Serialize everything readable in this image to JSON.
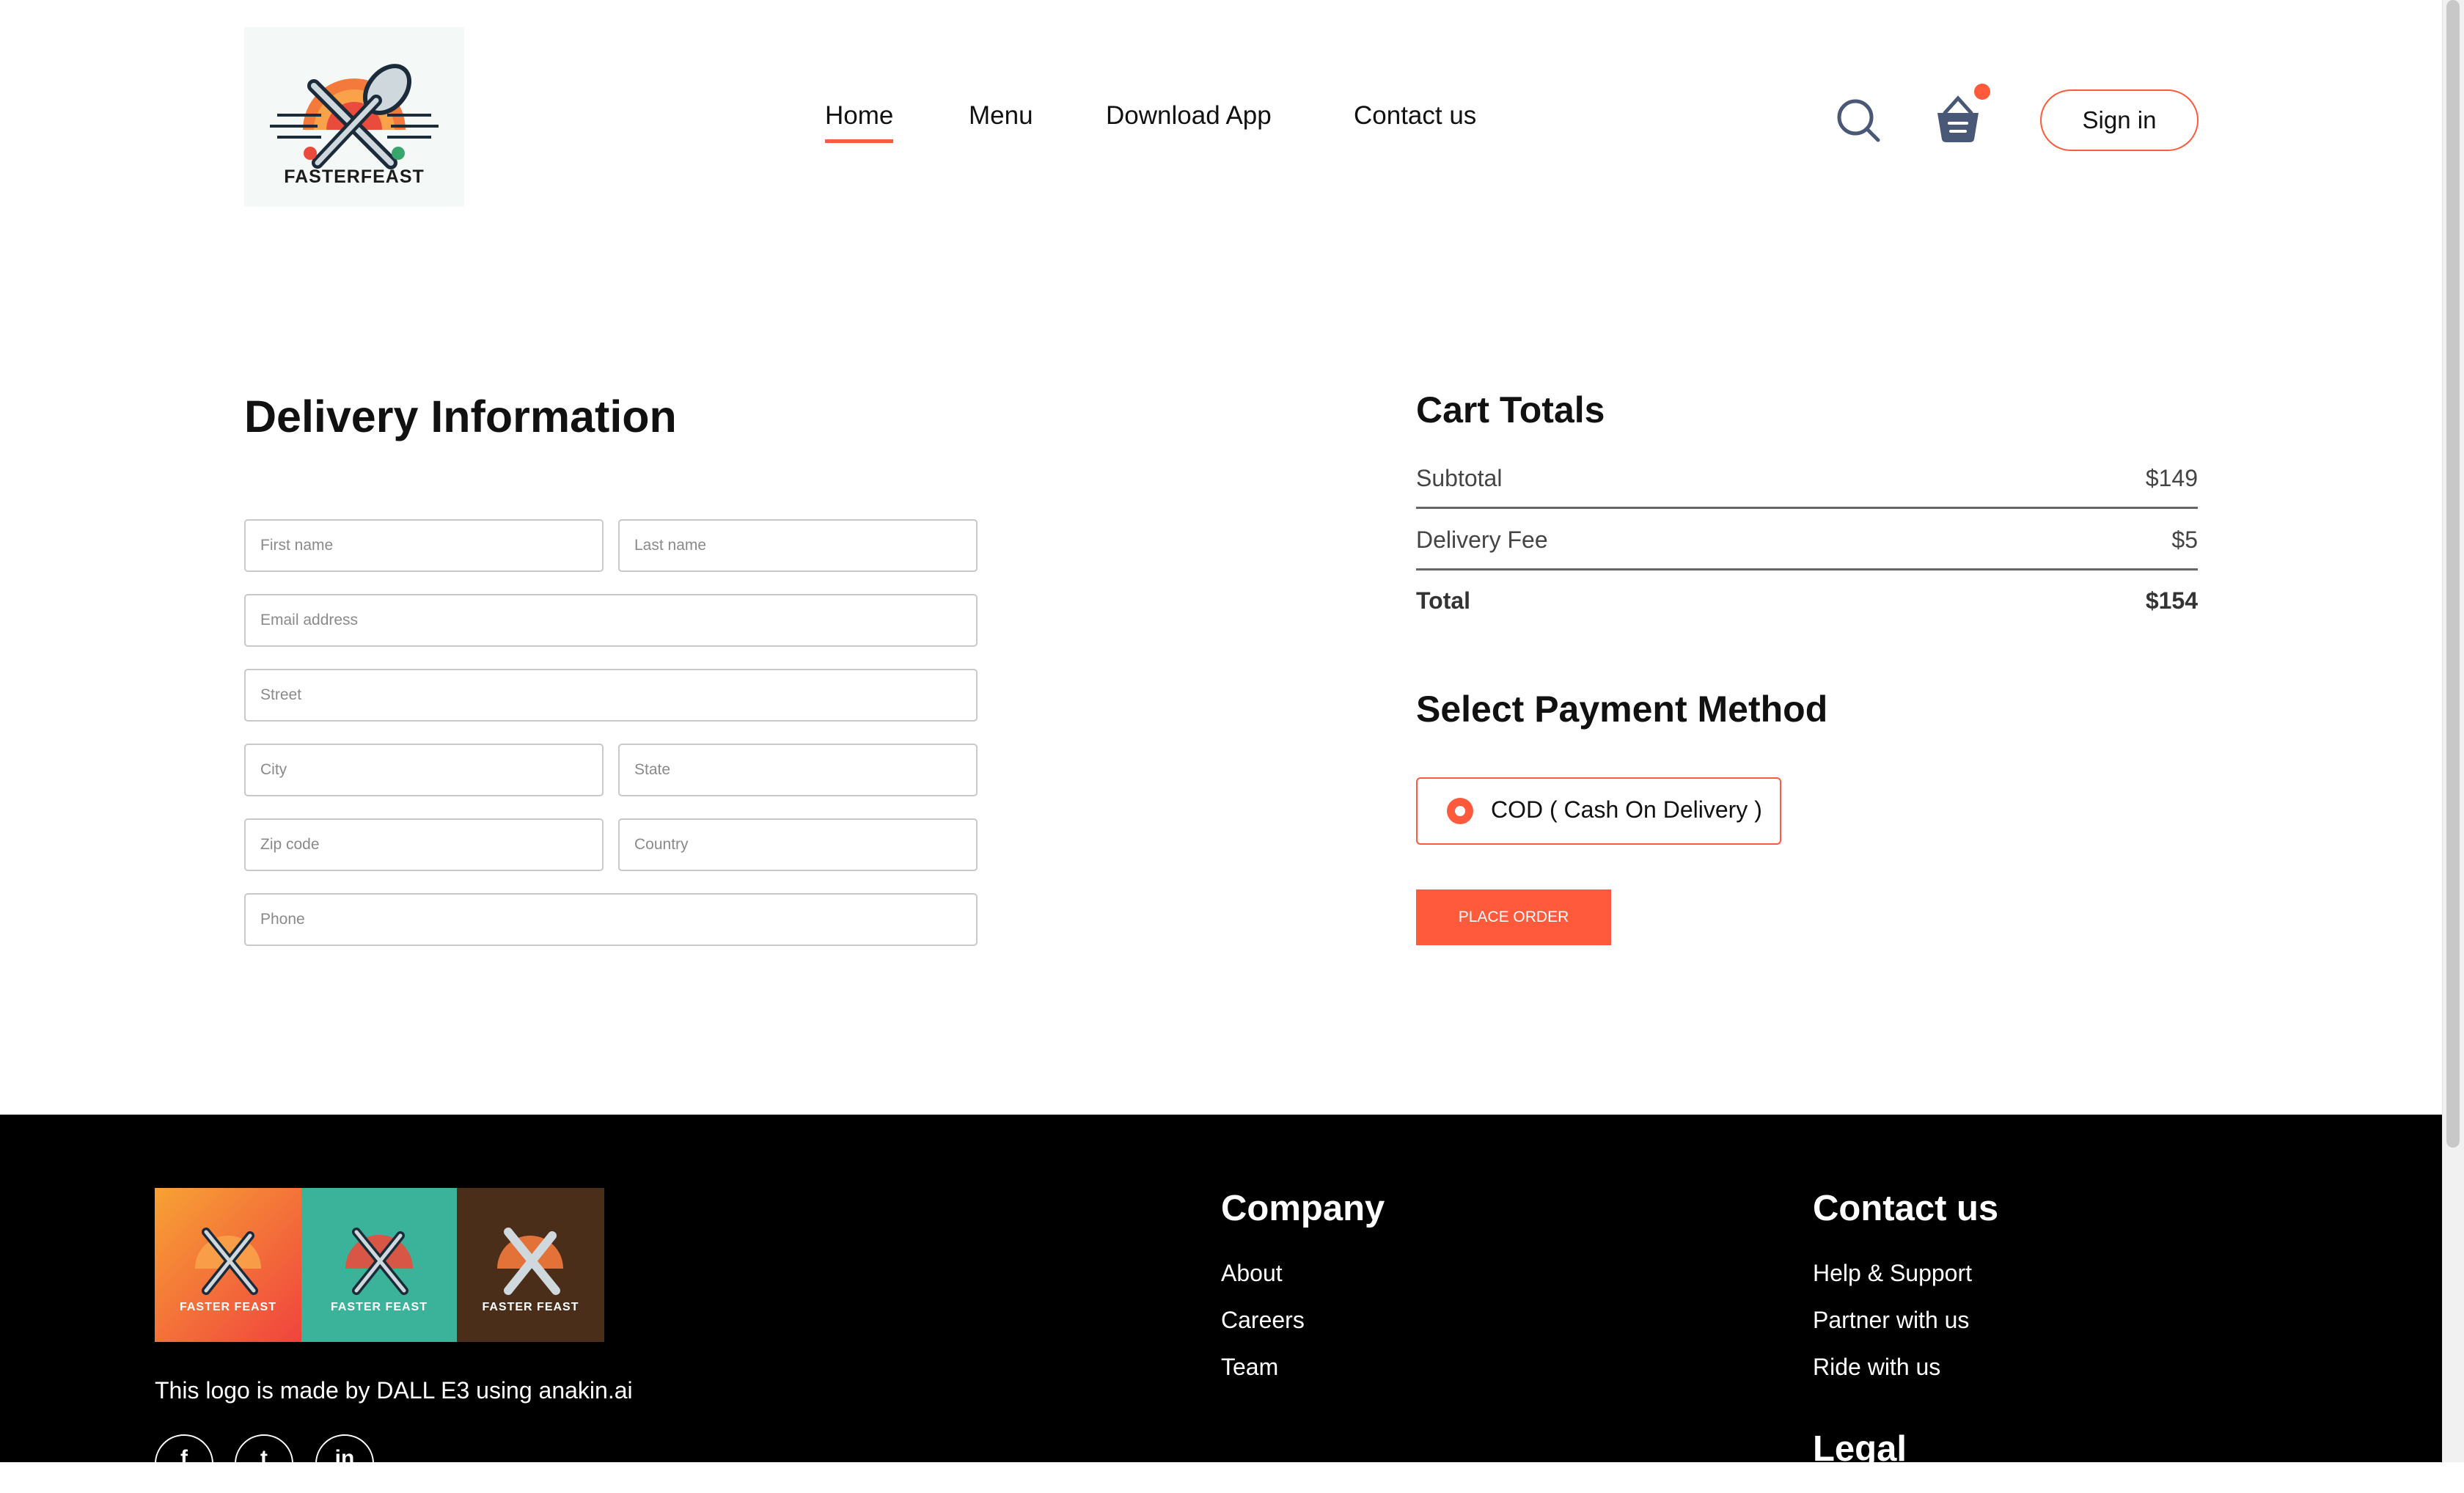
{
  "header": {
    "logo_text": "FASTERFEAST",
    "nav": [
      {
        "label": "Home",
        "active": true
      },
      {
        "label": "Menu"
      },
      {
        "label": "Download App"
      },
      {
        "label": "Contact us"
      }
    ],
    "search_icon": "search-icon",
    "cart_icon": "basket-icon",
    "sign_in_label": "Sign in"
  },
  "delivery": {
    "title": "Delivery Information",
    "placeholders": {
      "first_name": "First name",
      "last_name": "Last name",
      "email": "Email address",
      "street": "Street",
      "city": "City",
      "state": "State",
      "zip": "Zip code",
      "country": "Country",
      "phone": "Phone"
    }
  },
  "cart": {
    "title": "Cart Totals",
    "subtotal_label": "Subtotal",
    "subtotal_value": "$149",
    "fee_label": "Delivery Fee",
    "fee_value": "$5",
    "total_label": "Total",
    "total_value": "$154"
  },
  "payment": {
    "title": "Select Payment Method",
    "option_label": "COD ( Cash On Delivery )",
    "selected": true,
    "place_order_label": "PLACE ORDER"
  },
  "footer": {
    "logo_variants": [
      "FASTER FEAST",
      "FASTER FEAST",
      "FASTER FEAST"
    ],
    "logo_caption": "This logo is made by DALL E3 using anakin.ai",
    "company_title": "Company",
    "company_links": [
      "About",
      "Careers",
      "Team"
    ],
    "contact_title": "Contact us",
    "contact_links": [
      "Help & Support",
      "Partner with us",
      "Ride with us"
    ],
    "legal_title": "Legal",
    "social": [
      {
        "icon": "facebook-icon",
        "glyph": "f"
      },
      {
        "icon": "twitter-icon",
        "glyph": "t"
      },
      {
        "icon": "linkedin-icon",
        "glyph": "in"
      }
    ]
  },
  "colors": {
    "accent": "#ff5a3c",
    "footer_bg": "#000000",
    "text": "#111111"
  },
  "logo_display_text": "FASTERFEAST"
}
